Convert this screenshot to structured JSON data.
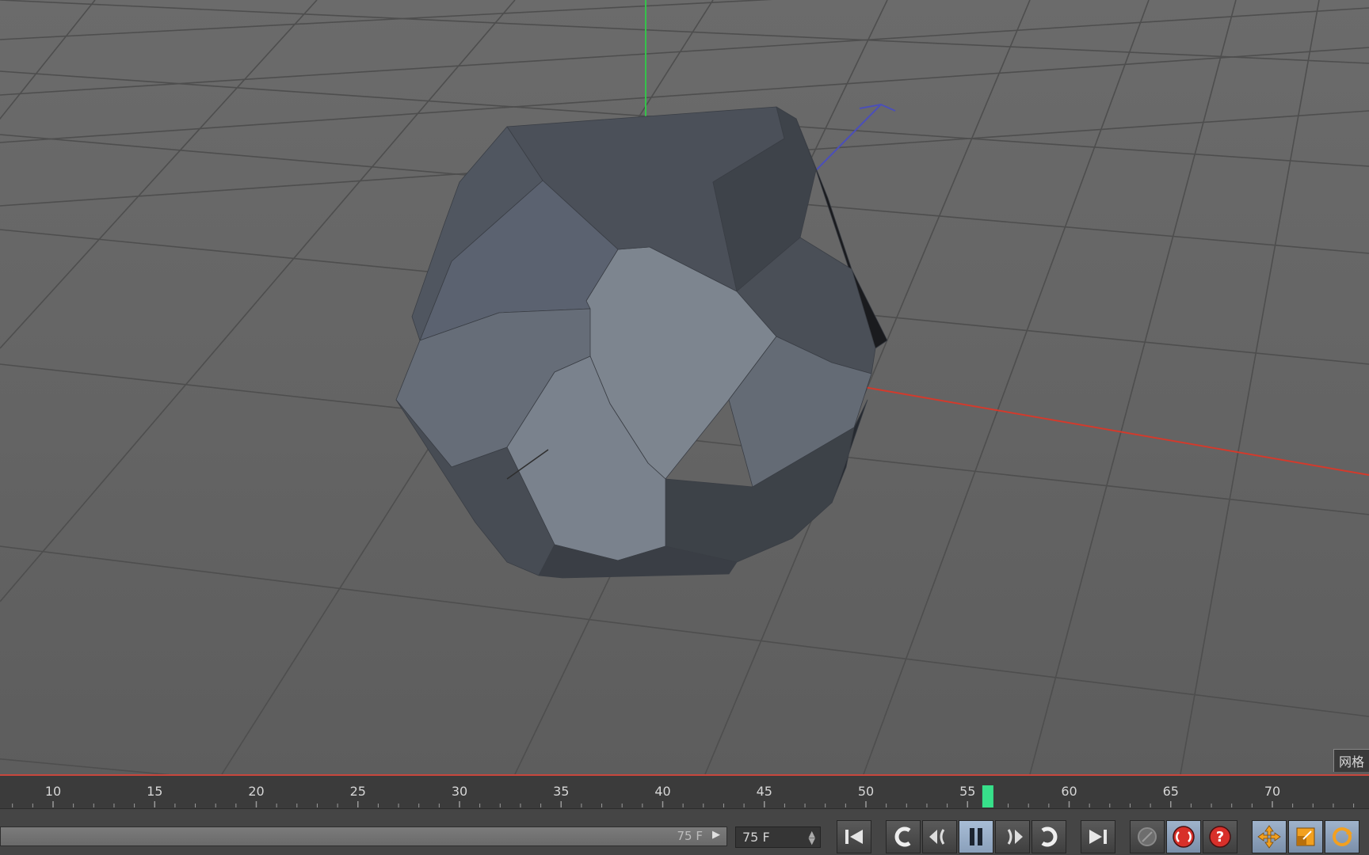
{
  "viewport": {
    "label": "网格",
    "colors": {
      "x_axis": "#d33a2c",
      "y_axis": "#35c24a",
      "z_axis": "#4b4fb8",
      "grid": "#4e4e4e"
    }
  },
  "timeline": {
    "ticks": [
      "10",
      "15",
      "20",
      "25",
      "30",
      "35",
      "40",
      "45",
      "50",
      "55",
      "60",
      "65",
      "70"
    ],
    "current_frame": 56,
    "playhead_color": "#37e08a"
  },
  "controls": {
    "range_end": "75 F",
    "frame_field": "75 F",
    "buttons": [
      {
        "name": "go-to-start-button",
        "icon": "skip-to-start-icon"
      },
      {
        "name": "previous-keyframe-button",
        "icon": "previous-key-icon"
      },
      {
        "name": "step-back-button",
        "icon": "step-back-icon"
      },
      {
        "name": "pause-button",
        "icon": "pause-icon"
      },
      {
        "name": "step-forward-button",
        "icon": "step-forward-icon"
      },
      {
        "name": "next-keyframe-button",
        "icon": "next-key-icon"
      },
      {
        "name": "go-to-end-button",
        "icon": "skip-to-end-icon"
      },
      {
        "name": "keyframe-selection-button",
        "icon": "key-selection-icon"
      },
      {
        "name": "record-button",
        "icon": "record-icon"
      },
      {
        "name": "autokey-button",
        "icon": "question-icon"
      },
      {
        "name": "move-tool-button",
        "icon": "move-icon"
      },
      {
        "name": "scale-tool-button",
        "icon": "scale-icon"
      },
      {
        "name": "rotate-tool-button",
        "icon": "rotate-icon"
      }
    ]
  }
}
